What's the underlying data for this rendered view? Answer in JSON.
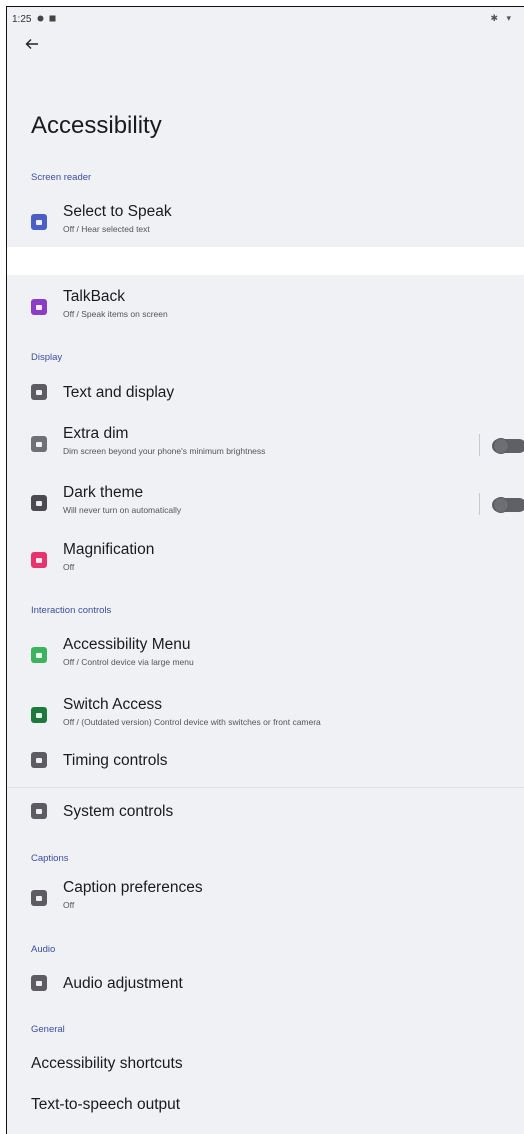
{
  "status_bar": {
    "time": "1:25",
    "right_icons": "✱ ▾"
  },
  "header": {
    "title": "Accessibility"
  },
  "colors": {
    "select_to_speak": "#4a5ec6",
    "talkback": "#8a3dc7",
    "text_display": "#5c5c62",
    "extra_dim": "#6f7076",
    "dark_theme": "#4a4a50",
    "magnification": "#e8336f",
    "accessibility_menu": "#3db35e",
    "switch_access": "#1e7a3c",
    "timing_controls": "#5c5c62",
    "system_controls": "#5c5c62",
    "caption_preferences": "#5c5c62",
    "audio_adjustment": "#5c5c62",
    "section_header": "#3b4ea0"
  },
  "sections": {
    "screen_reader": "Screen reader",
    "display": "Display",
    "interaction_controls": "Interaction controls",
    "captions": "Captions",
    "audio": "Audio",
    "general": "General"
  },
  "items": {
    "select_to_speak": {
      "title": "Select to Speak",
      "subtitle": "Off / Hear selected text",
      "icon": "speaker-icon"
    },
    "talkback": {
      "title": "TalkBack",
      "subtitle": "Off / Speak items on screen",
      "icon": "talkback-icon"
    },
    "text_display": {
      "title": "Text and display",
      "icon": "text-display-icon"
    },
    "extra_dim": {
      "title": "Extra dim",
      "subtitle": "Dim screen beyond your phone's minimum brightness",
      "icon": "brightness-icon",
      "toggle": false
    },
    "dark_theme": {
      "title": "Dark theme",
      "subtitle": "Will never turn on automatically",
      "icon": "dark-theme-icon",
      "toggle": false
    },
    "magnification": {
      "title": "Magnification",
      "subtitle": "Off",
      "icon": "magnify-icon"
    },
    "accessibility_menu": {
      "title": "Accessibility Menu",
      "subtitle": "Off / Control device via large menu",
      "icon": "menu-grid-icon"
    },
    "switch_access": {
      "title": "Switch Access",
      "subtitle": "Off / (Outdated version) Control device with switches or front camera",
      "icon": "switch-icon"
    },
    "timing_controls": {
      "title": "Timing controls",
      "icon": "timer-icon"
    },
    "system_controls": {
      "title": "System controls",
      "icon": "system-icon"
    },
    "caption_preferences": {
      "title": "Caption preferences",
      "subtitle": "Off",
      "icon": "caption-icon"
    },
    "audio_adjustment": {
      "title": "Audio adjustment",
      "icon": "audio-icon"
    },
    "accessibility_shortcuts": {
      "title": "Accessibility shortcuts"
    },
    "tts_output": {
      "title": "Text-to-speech output"
    }
  }
}
